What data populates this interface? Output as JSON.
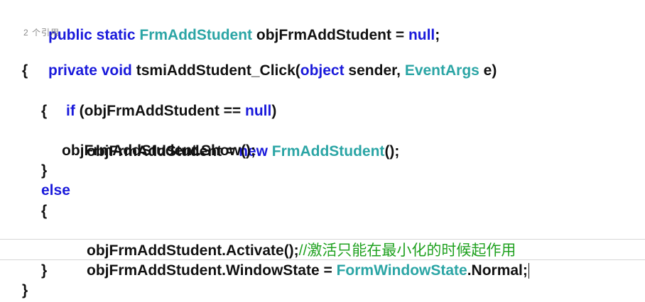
{
  "code": {
    "line1": {
      "kw1": "public static ",
      "type1": "FrmAddStudent",
      "rest": " objFrmAddStudent = ",
      "kw2": "null",
      "end": ";"
    },
    "codelens": "2 个引用",
    "line2": {
      "kw1": "private void ",
      "name": "tsmiAddStudent_Click(",
      "kw2": "object",
      "mid": " sender, ",
      "type1": "EventArgs",
      "end": " e)"
    },
    "line3": "{",
    "line4": {
      "kw1": "if",
      "mid": " (objFrmAddStudent == ",
      "kw2": "null",
      "end": ")"
    },
    "line5": "{",
    "line6": {
      "start": "objFrmAddStudent = ",
      "kw1": "new ",
      "type1": "FrmAddStudent",
      "end": "();"
    },
    "line7": "objFrmAddStudent.Show();",
    "line8": "}",
    "line9": "else",
    "line10": "{",
    "line11": {
      "code": "objFrmAddStudent.Activate();",
      "comment": "//激活只能在最小化的时候起作用"
    },
    "line12": {
      "start": "objFrmAddStudent.WindowState = ",
      "type1": "FormWindowState",
      "end": ".Normal;"
    },
    "line13": "}",
    "line14": "}"
  },
  "colors": {
    "keyword": "#1a1adb",
    "type": "#2ba5a5",
    "comment": "#1fa11f",
    "text": "#111111",
    "codelens": "#8a8a8a"
  }
}
